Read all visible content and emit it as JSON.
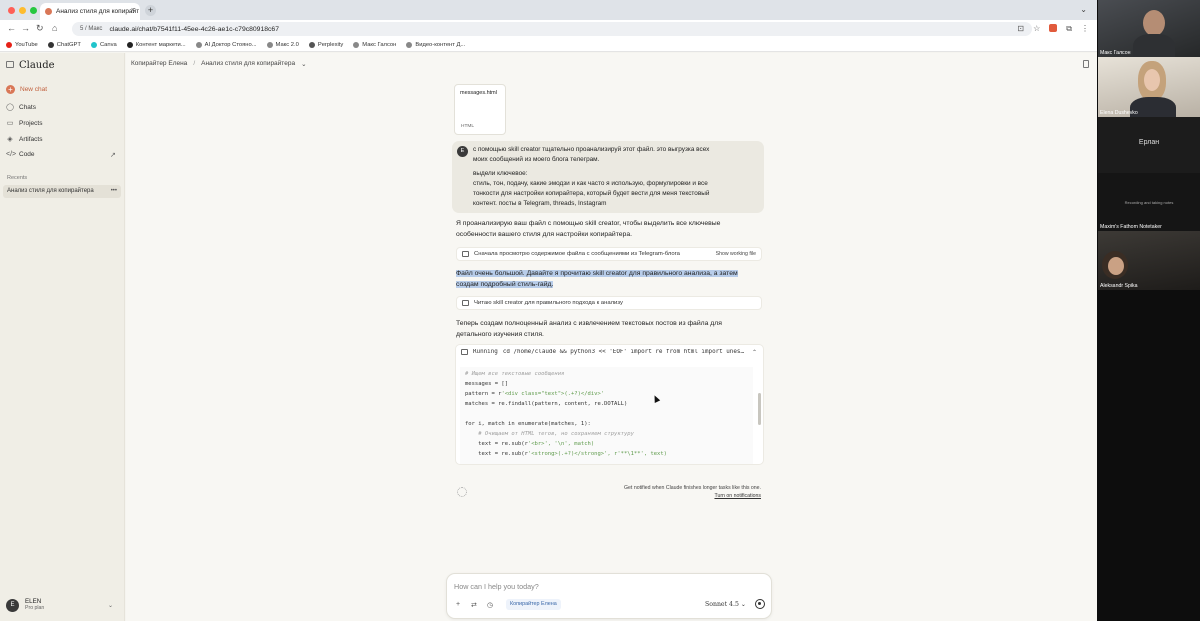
{
  "browser": {
    "tab_title": "Анализ стиля для копирайт",
    "omnibox_chip": "5 / Макс",
    "url": "claude.ai/chat/b7541f11-45ee-4c26-ae1c-c79c80918c67"
  },
  "bookmarks": [
    {
      "label": "YouTube",
      "color": "#e62117"
    },
    {
      "label": "ChatGPT",
      "color": "#333333"
    },
    {
      "label": "Canva",
      "color": "#20c4cb"
    },
    {
      "label": "Контент маркети...",
      "color": "#222222"
    },
    {
      "label": "AI Доктор Стоянo...",
      "color": "#888888"
    },
    {
      "label": "Макс 2.0",
      "color": "#888888"
    },
    {
      "label": "Perplexity",
      "color": "#555555"
    },
    {
      "label": "Макс Галсон",
      "color": "#888888"
    },
    {
      "label": "Видео-контент Д...",
      "color": "#888888"
    }
  ],
  "sidebar": {
    "logo": "Claude",
    "new_chat": "New chat",
    "items": [
      {
        "label": "Chats",
        "icon": "chat-bubble-icon"
      },
      {
        "label": "Projects",
        "icon": "folder-icon"
      },
      {
        "label": "Artifacts",
        "icon": "artifacts-icon"
      },
      {
        "label": "Code",
        "icon": "code-icon"
      }
    ],
    "recents_label": "Recents",
    "recent_item": "Анализ стиля для копирайтера",
    "user": {
      "initial": "E",
      "name": "ELEN",
      "plan": "Pro plan"
    }
  },
  "breadcrumb": {
    "project": "Копирайтер Елена",
    "chat": "Анализ стиля для копирайтера"
  },
  "attachment": {
    "name": "messages.html",
    "type": "HTML"
  },
  "user_message": {
    "initial": "E",
    "lines": [
      "с помощью skill creator тщательно проанализируй этот файл. это выгрузка всех",
      "моих сообщений из моего блога телеграм.",
      "выдели ключевое:",
      "стиль, тон, подачу, какие эмодзи и как часто я использую, формулировки и все",
      "тонкости для настройки копирайтера, который будет вести для меня текстовый",
      "контент. посты в Telegram, threads, Instagram"
    ]
  },
  "assistant": {
    "intro_lines": [
      "Я проанализирую ваш файл с помощью skill creator, чтобы выделить все ключевые",
      "особенности вашего стиля для настройки копирайтера."
    ],
    "tool1": {
      "label": "Сначала просмотрю содержимое файла с сообщениями из Telegram-блога",
      "action": "Show working file"
    },
    "highlight_lines": [
      "Файл очень большой. Давайте я прочитаю skill creator для правильного анализа, а затем",
      "создам подробный стиль-гайд."
    ],
    "tool2": {
      "label": "Читаю skill creator для правильного подхода к анализу"
    },
    "next_lines": [
      "Теперь создам полноценный анализ с извлечением текстовых постов из файла для",
      "детального изучения стиля."
    ],
    "code": {
      "running_label": "Running",
      "command": "cd /home/claude && python3 << 'EOF' import re from html import unes…",
      "lines": [
        {
          "t": "comment",
          "text": "# Ищем все текстовые сообщения"
        },
        {
          "t": "code",
          "text": "messages = []"
        },
        {
          "t": "mixed",
          "pre": "pattern = r",
          "str": "'<div class=\"text\">(.+?)</div>'"
        },
        {
          "t": "code",
          "text": "matches = re.findall(pattern, content, re.DOTALL)"
        },
        {
          "t": "code",
          "text": ""
        },
        {
          "t": "code",
          "text": "for i, match in enumerate(matches, 1):"
        },
        {
          "t": "comment",
          "text": "    # Очищаем от HTML тегов, но сохраняем структуру"
        },
        {
          "t": "mixed",
          "pre": "    text = re.sub(r",
          "str": "'<br>', '\\n', match)"
        },
        {
          "t": "mixed",
          "pre": "    text = re.sub(r",
          "str": "'<strong>(.+?)</strong>', r'**\\1**', text)"
        }
      ]
    },
    "notify_line1": "Get notified when Claude finishes longer tasks like this one.",
    "notify_link": "Turn on notifications"
  },
  "composer": {
    "placeholder": "How can I help you today?",
    "project_chip": "Копирайтер Елена",
    "model": "Sonnet 4.5"
  },
  "meeting": {
    "tiles": [
      {
        "name": "Макс Галсон"
      },
      {
        "name": "Elena Dushevko"
      },
      {
        "name": "Ерлан"
      },
      {
        "name": "Maxim's Fathom Notetaker",
        "status": "Recording and taking notes"
      },
      {
        "name": "Aleksandr Spika"
      }
    ]
  },
  "colors": {
    "accent": "#d97757",
    "highlight": "#b8cdea",
    "link": "#3967a8"
  }
}
